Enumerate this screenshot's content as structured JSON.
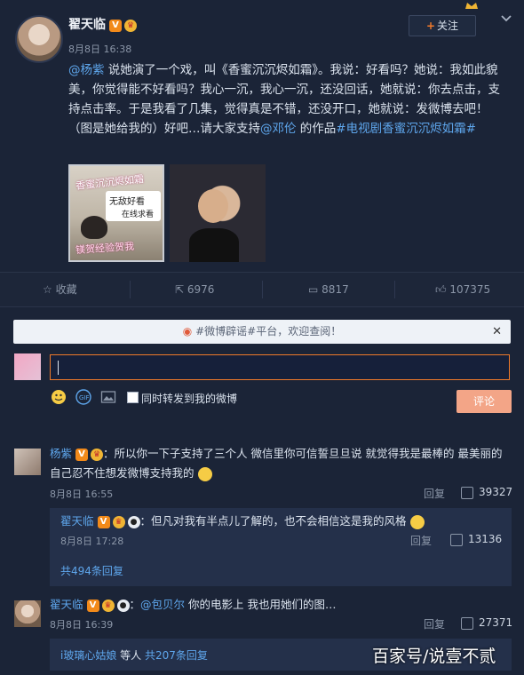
{
  "post": {
    "author": "翟天临",
    "time": "8月8日 16:38",
    "follow_label": "关注",
    "text_parts": [
      {
        "t": "@杨紫",
        "link": true
      },
      {
        "t": " 说她演了一个戏，叫《香蜜沉沉烬如霜》。我说：好看吗？她说：我如此貌美，你觉得能不好看吗？我心一沉，我心一沉，还没回话，她就说：你去点击，支持点击率。于是我看了几集，觉得真是不错，还没开口，她就说：发微博去吧！（图是她给我的）好吧…请大家支持",
        "link": false
      },
      {
        "t": "@邓伦",
        "link": true
      },
      {
        "t": " 的作品",
        "link": false
      },
      {
        "t": "#电视剧香蜜沉沉烬如霜#",
        "link": true
      }
    ],
    "image1_texts": [
      "香蜜沉沉烬如霜",
      "无敌好看",
      "在线求看",
      "镁贺经验贺我"
    ],
    "actions": {
      "favorite": "收藏",
      "repost": "6976",
      "comment": "8817",
      "like": "107375"
    }
  },
  "notice": {
    "text": "#微博辟谣#平台，欢迎查阅！"
  },
  "composer": {
    "value": "",
    "sync_label": "同时转发到我的微博",
    "submit_label": "评论"
  },
  "comments": [
    {
      "author": "杨紫",
      "text": "所以你一下子支持了三个人 微信里你可信誓旦旦说 就觉得我是最棒的 最美丽的 自己忍不住想发微博支持我的",
      "time": "8月8日 16:55",
      "reply_label": "回复",
      "likes": "39327",
      "reply": {
        "author": "翟天临",
        "text": "但凡对我有半点儿了解的，也不会相信这是我的风格",
        "time": "8月8日 17:28",
        "reply_label": "回复",
        "likes": "13136",
        "more": "共494条回复"
      }
    },
    {
      "author": "翟天临",
      "mention": "@包贝尔",
      "text": "你的电影上 我也用她们的图…",
      "time": "8月8日 16:39",
      "reply_label": "回复",
      "likes": "27371",
      "sub_prefix": "i玻璃心姑娘",
      "sub_middle": " 等人 ",
      "sub_more": "共207条回复"
    }
  ],
  "watermark": "百家号/说壹不贰"
}
